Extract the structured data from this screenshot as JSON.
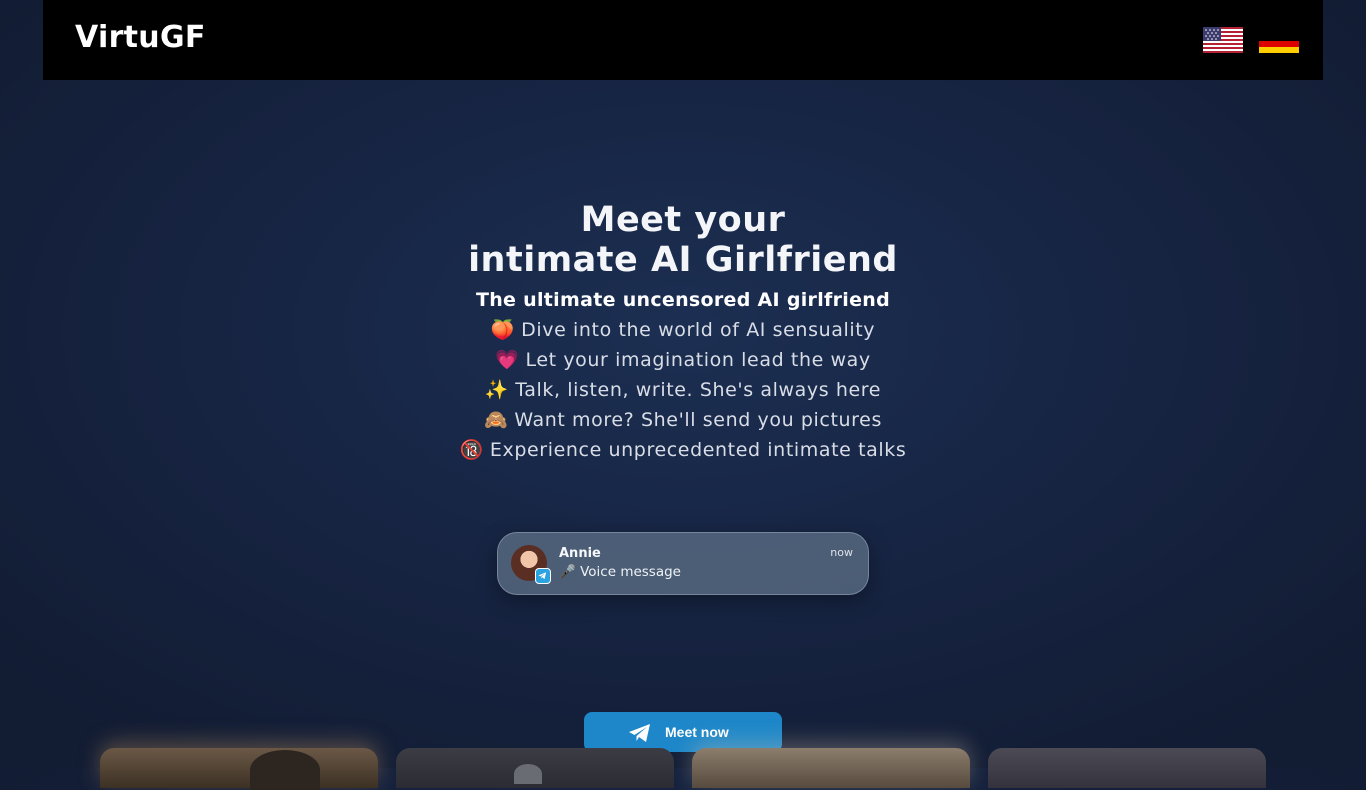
{
  "header": {
    "logo": "VirtuGF",
    "languages": [
      {
        "code": "en",
        "icon": "us-flag-icon"
      },
      {
        "code": "de",
        "icon": "german-flag-icon"
      }
    ]
  },
  "hero": {
    "title_line1": "Meet your",
    "title_line2": "intimate AI Girlfriend",
    "subtitle": "The ultimate uncensored AI girlfriend",
    "features": [
      {
        "emoji": "🍑",
        "text": "Dive into the world of AI sensuality"
      },
      {
        "emoji": "💗",
        "text": "Let your imagination lead the way"
      },
      {
        "emoji": "✨",
        "text": "Talk, listen, write. She's always here"
      },
      {
        "emoji": "🙈",
        "text": "Want more? She'll send you pictures"
      },
      {
        "emoji": "🔞",
        "text": "Experience unprecedented intimate talks"
      }
    ]
  },
  "notification": {
    "name": "Annie",
    "message": "🎤 Voice message",
    "time": "now"
  },
  "cta": {
    "label": "Meet now",
    "icon": "telegram-plane-icon"
  },
  "colors": {
    "header_bg": "#000000",
    "page_bg": "#172544",
    "cta_bg": "#1d87c9"
  }
}
